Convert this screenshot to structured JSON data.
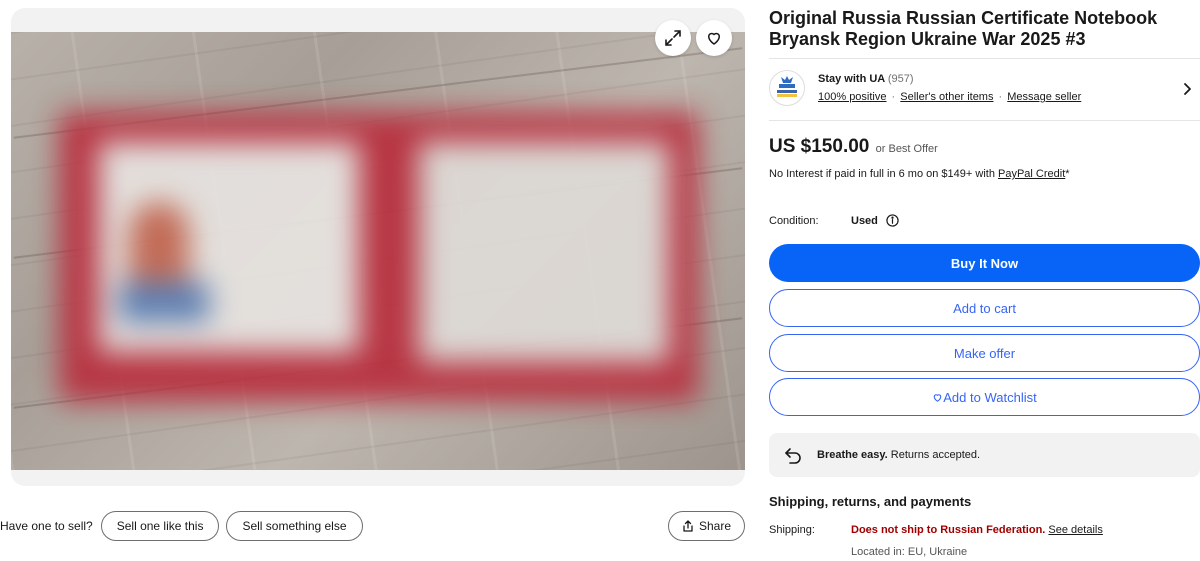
{
  "listing": {
    "title": "Original Russia Russian Certificate Notebook Bryansk Region Ukraine War 2025 #3"
  },
  "seller": {
    "name": "Stay with UA",
    "feedback_count": "(957)",
    "positive": "100% positive",
    "other_items": "Seller's other items",
    "message": "Message seller",
    "logo_icon": "seller-logo"
  },
  "price": {
    "amount": "US $150.00",
    "offer_note": "or Best Offer",
    "credit_prefix": "No Interest if paid in full in 6 mo on $149+ with ",
    "credit_link": "PayPal Credit",
    "credit_suffix": "*"
  },
  "condition": {
    "label": "Condition:",
    "value": "Used"
  },
  "actions": {
    "buy_now": "Buy It Now",
    "add_to_cart": "Add to cart",
    "make_offer": "Make offer",
    "watchlist": "Add to Watchlist"
  },
  "returns": {
    "bold": "Breathe easy.",
    "text": " Returns accepted."
  },
  "shipping": {
    "heading": "Shipping, returns, and payments",
    "label": "Shipping:",
    "value": "Does not ship to Russian Federation.",
    "details_link": "See details",
    "location": "Located in: EU, Ukraine"
  },
  "gallery": {
    "sell_prompt": "Have one to sell?",
    "sell_one": "Sell one like this",
    "sell_else": "Sell something else",
    "share": "Share"
  },
  "colors": {
    "primary": "#0764f7",
    "link_blue": "#3665f3",
    "warning_red": "#a00000"
  }
}
